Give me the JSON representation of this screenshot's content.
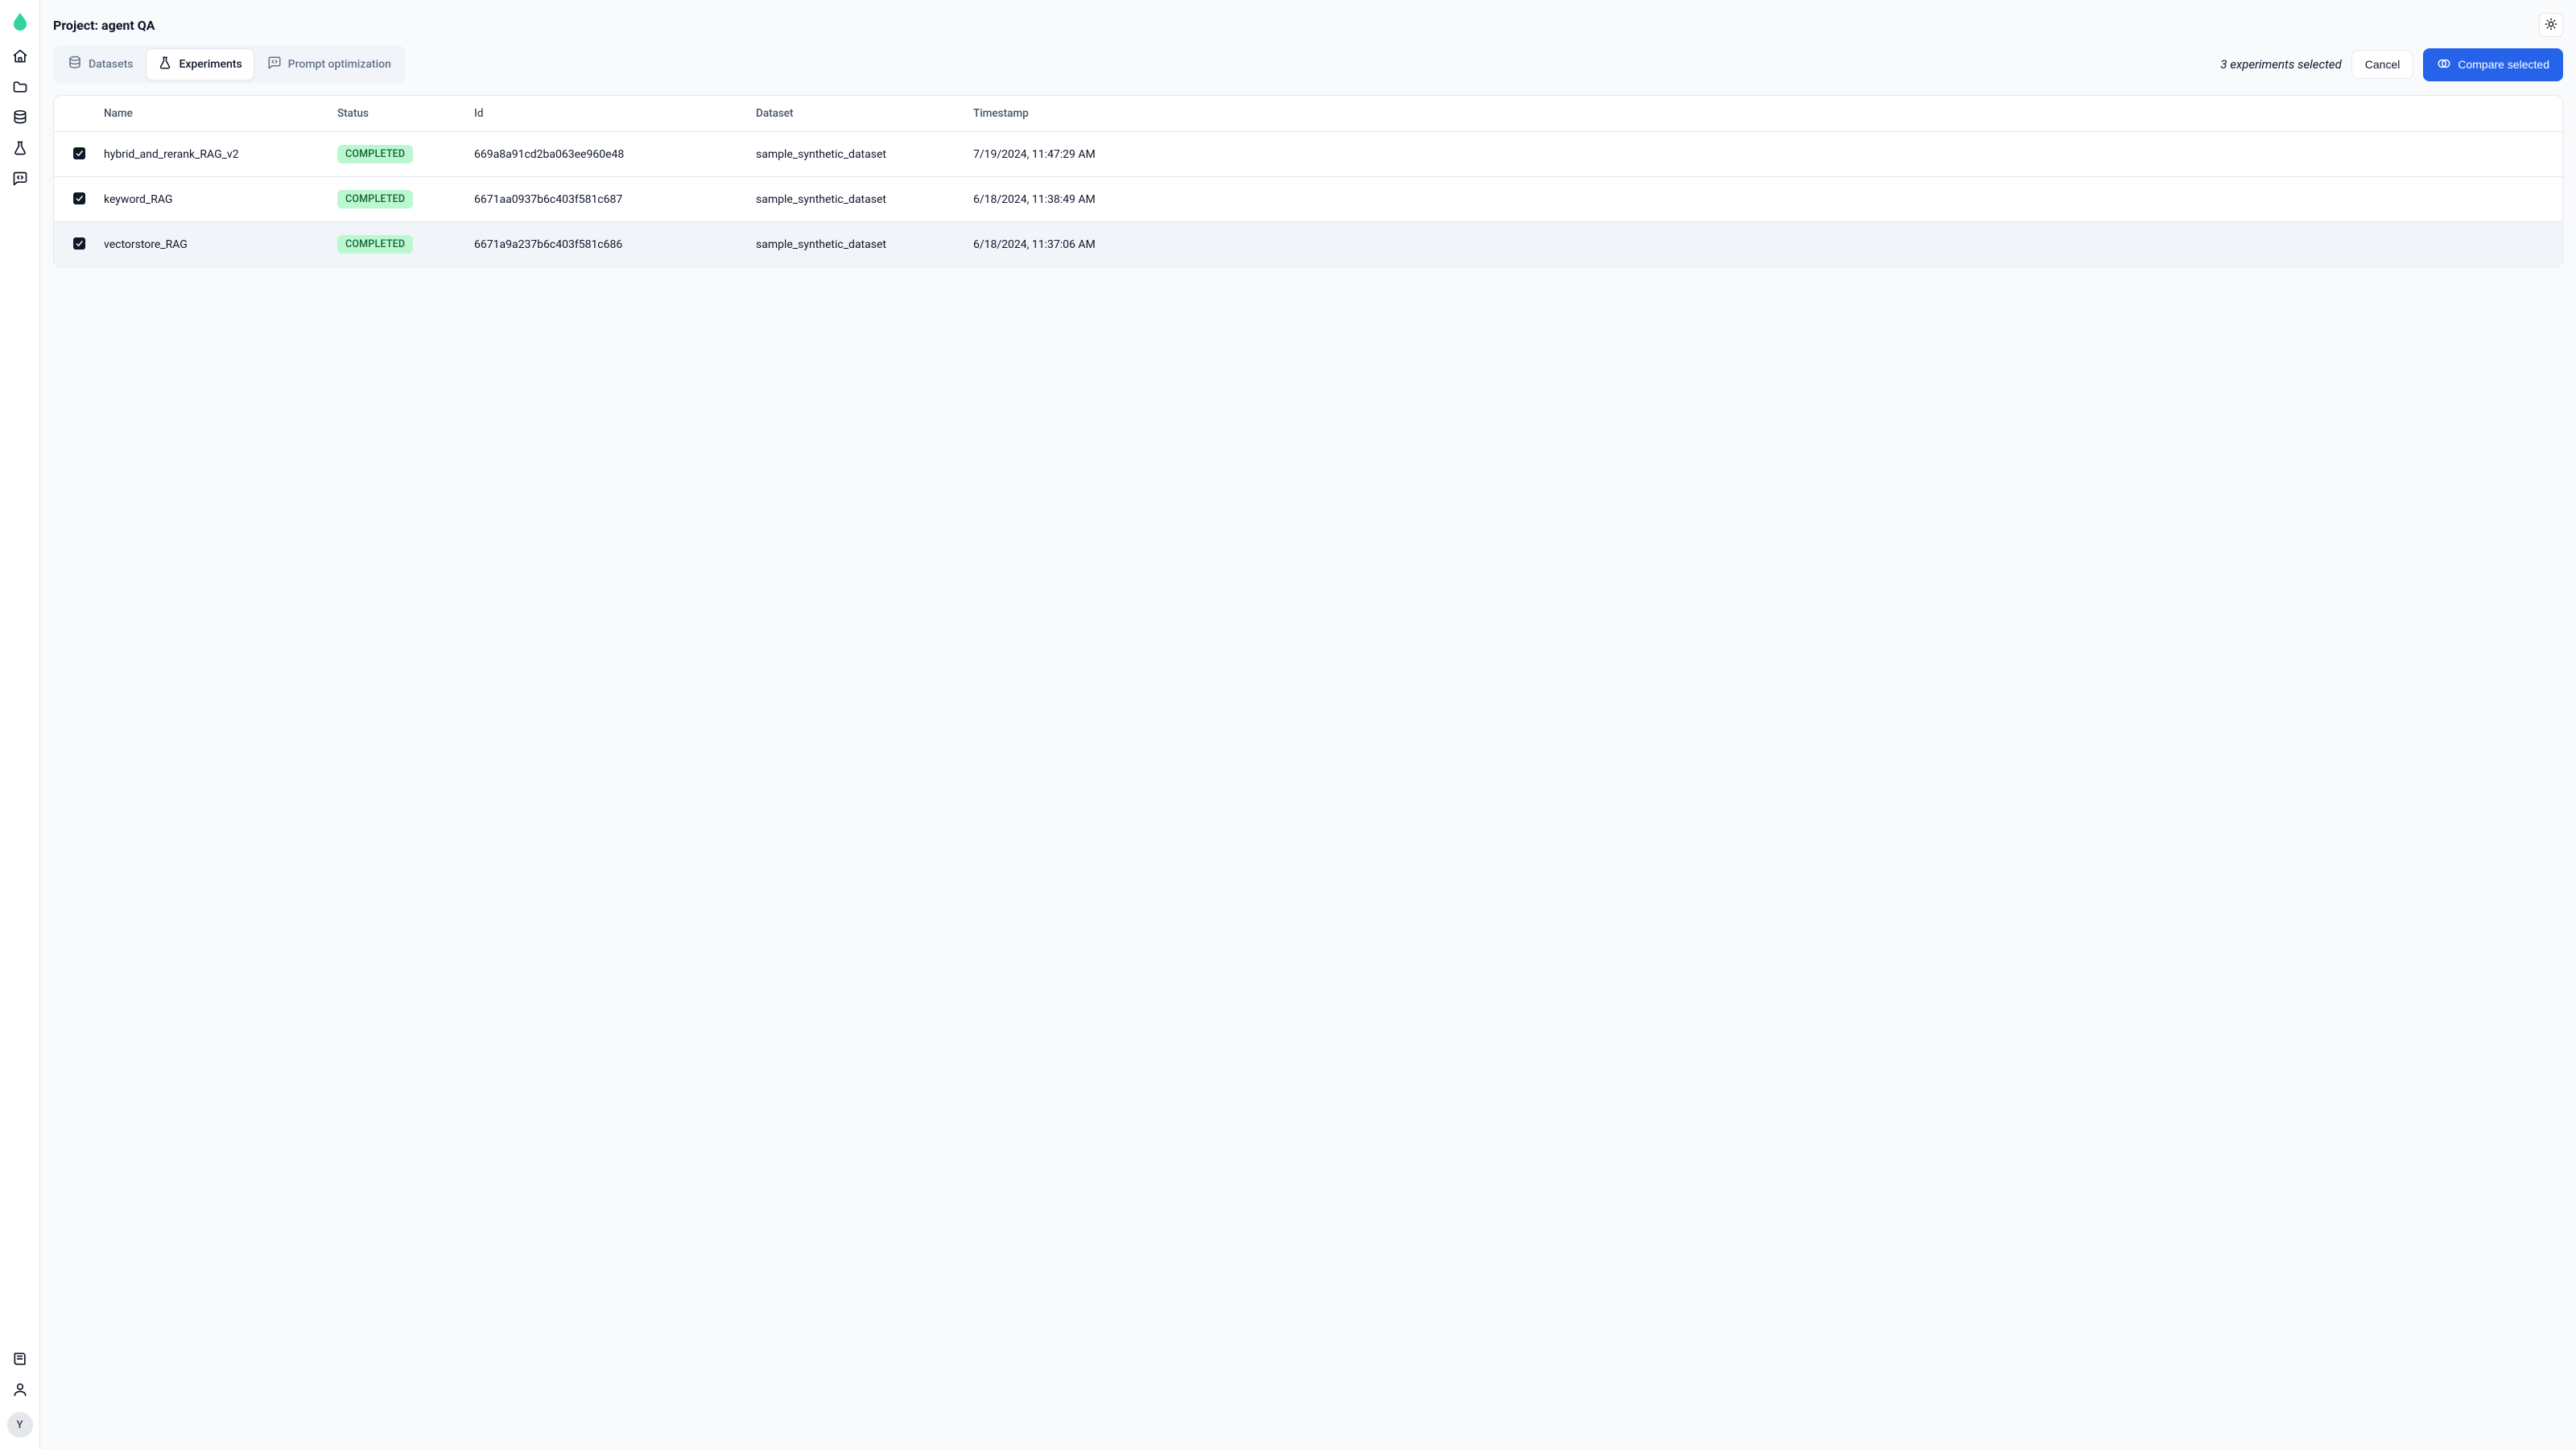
{
  "header": {
    "title": "Project: agent QA"
  },
  "sidebar": {
    "avatar_initial": "Y"
  },
  "tabs": {
    "items": [
      {
        "key": "datasets",
        "label": "Datasets"
      },
      {
        "key": "experiments",
        "label": "Experiments"
      },
      {
        "key": "prompt_optimization",
        "label": "Prompt optimization"
      }
    ],
    "active": "experiments"
  },
  "selection": {
    "summary": "3 experiments selected",
    "cancel_label": "Cancel",
    "compare_label": "Compare selected"
  },
  "table": {
    "columns": [
      "Name",
      "Status",
      "Id",
      "Dataset",
      "Timestamp"
    ],
    "rows": [
      {
        "checked": true,
        "name": "hybrid_and_rerank_RAG_v2",
        "status": "COMPLETED",
        "id": "669a8a91cd2ba063ee960e48",
        "dataset": "sample_synthetic_dataset",
        "timestamp": "7/19/2024, 11:47:29 AM"
      },
      {
        "checked": true,
        "name": "keyword_RAG",
        "status": "COMPLETED",
        "id": "6671aa0937b6c403f581c687",
        "dataset": "sample_synthetic_dataset",
        "timestamp": "6/18/2024, 11:38:49 AM"
      },
      {
        "checked": true,
        "name": "vectorstore_RAG",
        "status": "COMPLETED",
        "id": "6671a9a237b6c403f581c686",
        "dataset": "sample_synthetic_dataset",
        "timestamp": "6/18/2024, 11:37:06 AM"
      }
    ]
  },
  "colors": {
    "primary": "#2563eb",
    "badge_bg": "#bbf7d0",
    "badge_fg": "#166534"
  }
}
